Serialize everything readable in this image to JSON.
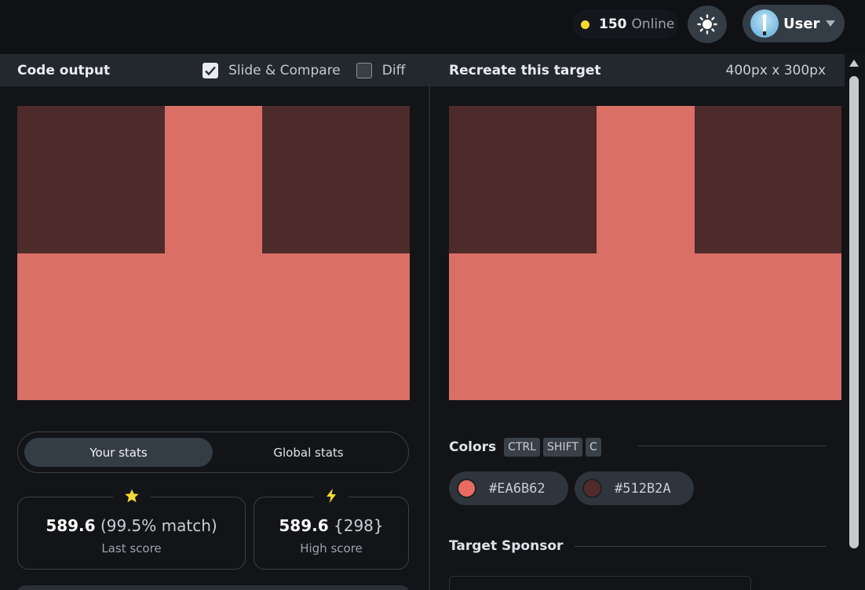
{
  "header": {
    "online_count": "150",
    "online_label": "Online",
    "user_name": "User",
    "icons": {
      "status_dot": "online-dot-icon",
      "theme": "sun-icon",
      "user": "avatar",
      "menu": "chevron-down-icon"
    }
  },
  "left_panel": {
    "title": "Code output",
    "slide_compare_label": "Slide & Compare",
    "slide_compare_checked": true,
    "diff_label": "Diff",
    "diff_checked": false
  },
  "right_panel": {
    "title": "Recreate this target",
    "dimensions": "400px x 300px"
  },
  "stats": {
    "tabs": [
      "Your stats",
      "Global stats"
    ],
    "active_tab": "Your stats",
    "last_score_value": "589.6",
    "last_score_match": "(99.5% match)",
    "last_score_label": "Last score",
    "high_score_value": "589.6",
    "high_score_extra": "{298}",
    "high_score_label": "High score"
  },
  "colors": {
    "title": "Colors",
    "shortcut_keys": [
      "CTRL",
      "SHIFT",
      "C"
    ],
    "swatches": [
      {
        "hex": "#EA6B62"
      },
      {
        "hex": "#512B2A"
      }
    ]
  },
  "sponsor": {
    "title": "Target Sponsor"
  },
  "theme_colors": {
    "canvas_light": "#DA6F66",
    "canvas_dark": "#4D2B2B",
    "accent_dot": "#F6D935",
    "star": "#F6D935",
    "bolt": "#F6D935"
  }
}
